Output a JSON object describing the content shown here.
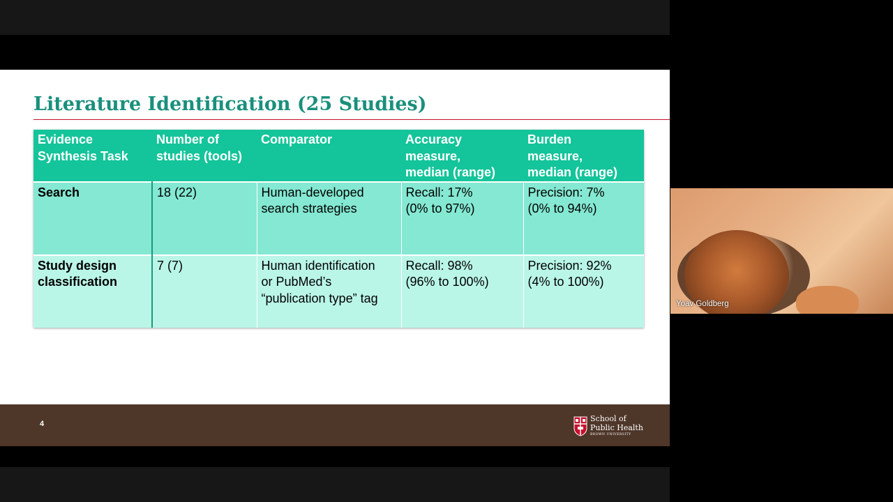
{
  "slide": {
    "title": "Literature Identification (25 Studies)",
    "page_number": "4",
    "table": {
      "headers": [
        "Evidence\nSynthesis Task",
        "Number of\nstudies (tools)",
        "Comparator",
        "Accuracy\nmeasure,\nmedian (range)",
        "Burden\nmeasure,\nmedian (range)"
      ],
      "rows": [
        [
          "Search",
          "18 (22)",
          "Human-developed\nsearch strategies",
          "Recall: 17%\n(0% to 97%)",
          "Precision: 7%\n(0% to 94%)"
        ],
        [
          "Study design\n classification",
          "7 (7)",
          "Human identification\n or PubMed’s\n“publication type” tag",
          "Recall: 98%\n (96% to 100%)",
          "Precision: 92%\n (4% to 100%)"
        ]
      ]
    },
    "logo": {
      "line1": "School of",
      "line2": "Public Health",
      "line3": "BROWN UNIVERSITY"
    }
  },
  "video": {
    "participant_name": "Yoav Goldberg"
  },
  "colors": {
    "title": "#1a8f7c",
    "header_bg": "#14c49a",
    "row1_bg": "#84e8d2",
    "row2_bg": "#baf6e8",
    "footer_bg": "#4e3629",
    "accent_rule": "#c8102e"
  }
}
